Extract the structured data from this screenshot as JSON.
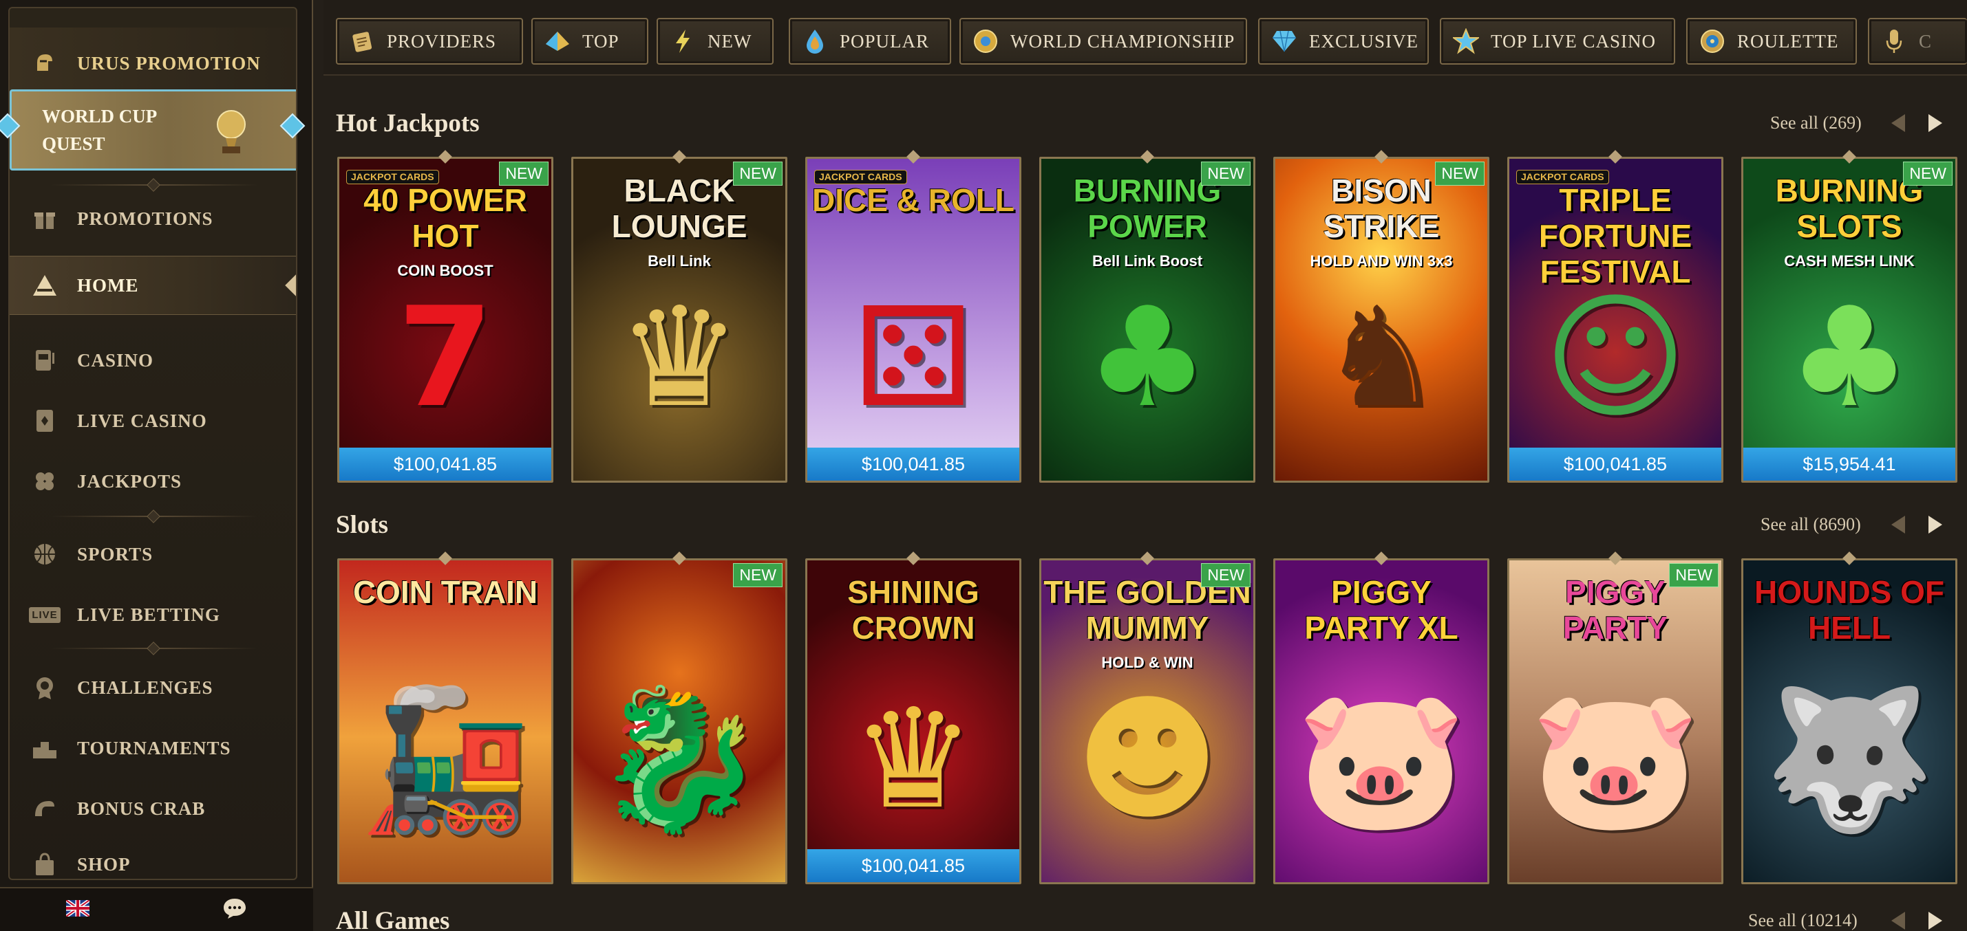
{
  "sidebar": {
    "promo": {
      "label": "URUS PROMOTION",
      "icon": "helmet-icon"
    },
    "quest": {
      "label_line1": "WORLD CUP",
      "label_line2": "QUEST",
      "icon": "trophy-icon"
    },
    "items": [
      {
        "label": "PROMOTIONS",
        "icon": "gift-icon"
      },
      {
        "label": "HOME",
        "icon": "home-icon",
        "active": true
      },
      {
        "label": "CASINO",
        "icon": "slot-machine-icon"
      },
      {
        "label": "LIVE CASINO",
        "icon": "card-icon"
      },
      {
        "label": "JACKPOTS",
        "icon": "clover-icon"
      },
      {
        "label": "SPORTS",
        "icon": "basketball-icon"
      },
      {
        "label": "LIVE BETTING",
        "icon": "live-badge-icon",
        "badge": "LIVE"
      },
      {
        "label": "CHALLENGES",
        "icon": "medal-icon"
      },
      {
        "label": "TOURNAMENTS",
        "icon": "podium-icon"
      },
      {
        "label": "BONUS CRAB",
        "icon": "claw-icon"
      },
      {
        "label": "SHOP",
        "icon": "bag-icon"
      }
    ],
    "bottom": {
      "language_icon": "uk-flag-icon",
      "chat_icon": "chat-icon"
    }
  },
  "topnav": {
    "tabs": [
      {
        "label": "PROVIDERS",
        "icon": "scroll-icon"
      },
      {
        "label": "TOP",
        "icon": "pyramid-icon"
      },
      {
        "label": "NEW",
        "icon": "lightning-icon"
      },
      {
        "label": "POPULAR",
        "icon": "drop-icon"
      },
      {
        "label": "WORLD CHAMPIONSHIP",
        "icon": "globe-ball-icon"
      },
      {
        "label": "EXCLUSIVE",
        "icon": "diamond-icon"
      },
      {
        "label": "TOP LIVE CASINO",
        "icon": "star-icon"
      },
      {
        "label": "ROULETTE",
        "icon": "roulette-icon"
      },
      {
        "label": "C",
        "icon": "microphone-icon"
      }
    ]
  },
  "sections": {
    "hot_jackpots": {
      "title": "Hot Jackpots",
      "see_all": "See all (269)"
    },
    "slots": {
      "title": "Slots",
      "see_all": "See all (8690)"
    },
    "all_games": {
      "title": "All Games",
      "see_all": "See all (10214)"
    }
  },
  "games": {
    "hot": [
      {
        "title": "40 POWER HOT",
        "subtitle": "COIN BOOST",
        "is_new": true,
        "badge": "NEW",
        "jackpot": "$100,041.85",
        "tag": "JACKPOT CARDS"
      },
      {
        "title": "BLACK LOUNGE",
        "subtitle": "Bell Link",
        "is_new": true,
        "badge": "NEW",
        "jackpot": ""
      },
      {
        "title": "Dice & Roll",
        "subtitle": "",
        "is_new": false,
        "badge": "",
        "jackpot": "$100,041.85",
        "tag": "JACKPOT CARDS"
      },
      {
        "title": "BURNING POWER",
        "subtitle": "Bell Link Boost",
        "is_new": true,
        "badge": "NEW",
        "jackpot": ""
      },
      {
        "title": "BISON STRIKE",
        "subtitle": "HOLD AND WIN 3x3",
        "is_new": true,
        "badge": "NEW",
        "jackpot": ""
      },
      {
        "title": "TRIPLE FORTUNE FESTIVAL",
        "subtitle": "",
        "is_new": false,
        "badge": "",
        "jackpot": "$100,041.85",
        "tag": "JACKPOT CARDS"
      },
      {
        "title": "BURNING SLOTS",
        "subtitle": "CASH MESH LINK",
        "is_new": true,
        "badge": "NEW",
        "jackpot": "$15,954.41"
      }
    ],
    "slots": [
      {
        "title": "COIN TRAIN",
        "subtitle": "",
        "is_new": false,
        "badge": "",
        "jackpot": ""
      },
      {
        "title": "",
        "subtitle": "",
        "is_new": true,
        "badge": "NEW",
        "jackpot": ""
      },
      {
        "title": "SHINING CROWN",
        "subtitle": "",
        "is_new": false,
        "badge": "",
        "jackpot": "$100,041.85"
      },
      {
        "title": "THE GOLDEN MUMMY",
        "subtitle": "HOLD & WIN",
        "is_new": true,
        "badge": "NEW",
        "jackpot": ""
      },
      {
        "title": "PIGGY PARTY XL",
        "subtitle": "",
        "is_new": false,
        "badge": "",
        "jackpot": ""
      },
      {
        "title": "Piggy Party",
        "subtitle": "",
        "is_new": true,
        "badge": "NEW",
        "jackpot": ""
      },
      {
        "title": "HOUNDS OF HELL",
        "subtitle": "",
        "is_new": false,
        "badge": "",
        "jackpot": ""
      }
    ]
  },
  "colors": {
    "accent_gold": "#d2b26c",
    "jackpot_blue": "#1f8ad6",
    "new_green": "#3aa34a",
    "quest_border": "#7ac4d8"
  }
}
